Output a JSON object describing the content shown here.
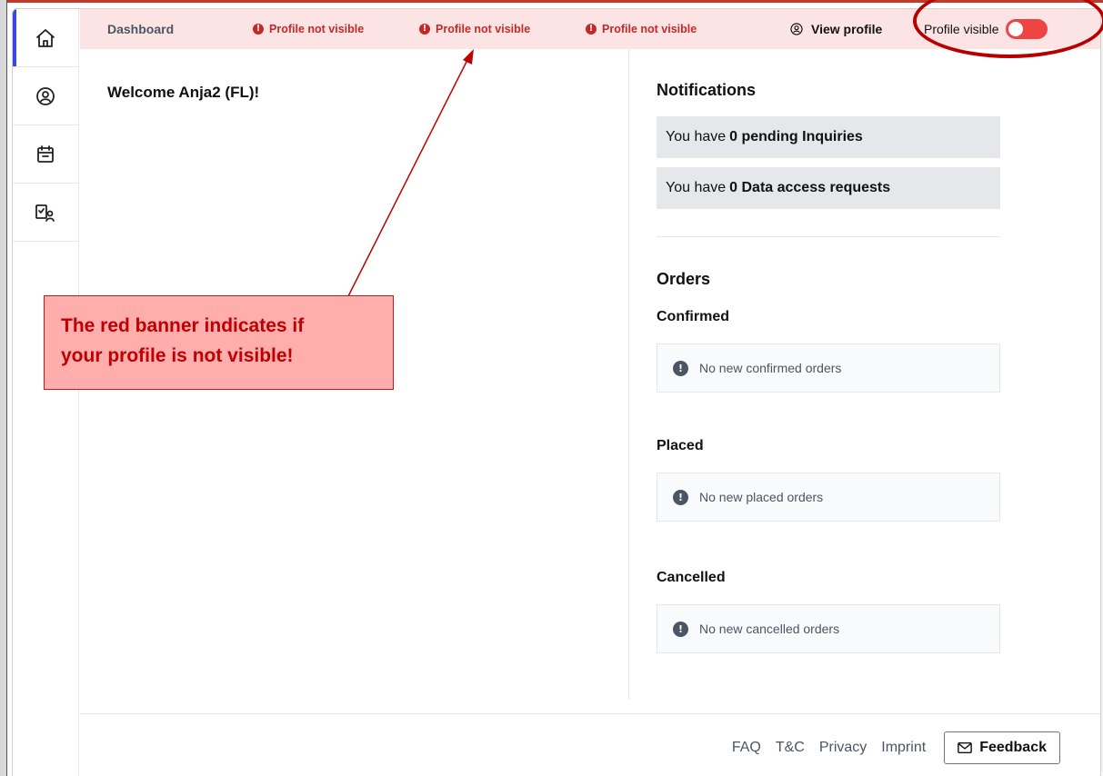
{
  "sidebar": {
    "items": [
      {
        "icon": "home-icon",
        "active": true
      },
      {
        "icon": "user-circle-icon",
        "active": false
      },
      {
        "icon": "calendar-icon",
        "active": false
      },
      {
        "icon": "checklist-user-icon",
        "active": false
      }
    ]
  },
  "banner": {
    "breadcrumb": "Dashboard",
    "warnings": [
      "Profile not visible",
      "Profile not visible",
      "Profile not visible"
    ],
    "warning_icon": "!",
    "view_profile": "View profile",
    "visibility_label": "Profile visible",
    "visibility_on": false,
    "background": "#fde4e4",
    "warning_color": "#c62828"
  },
  "main": {
    "welcome": "Welcome Anja2 (FL)!"
  },
  "notifications": {
    "title": "Notifications",
    "items": [
      {
        "prefix": "You have",
        "bold": "0 pending Inquiries"
      },
      {
        "prefix": "You have",
        "bold": "0 Data access requests"
      }
    ]
  },
  "orders": {
    "title": "Orders",
    "info_icon": "!",
    "sections": [
      {
        "title": "Confirmed",
        "message": "No new confirmed orders"
      },
      {
        "title": "Placed",
        "message": "No new placed orders"
      },
      {
        "title": "Cancelled",
        "message": "No new cancelled orders"
      }
    ]
  },
  "footer": {
    "links": [
      "FAQ",
      "T&C",
      "Privacy",
      "Imprint"
    ],
    "feedback_label": "Feedback"
  },
  "annotation": {
    "callout_line1": "The red banner indicates if",
    "callout_line2": "your profile is not visible!",
    "color": "#c00000"
  }
}
